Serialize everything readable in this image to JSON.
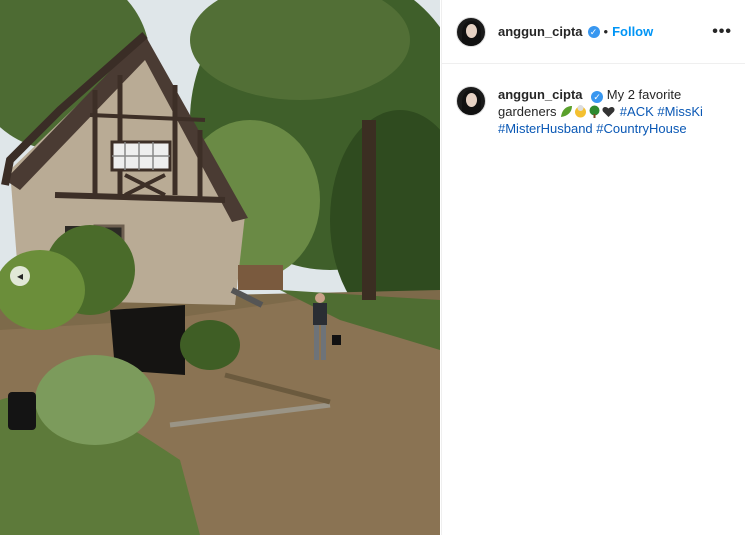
{
  "post": {
    "username": "anggun_cipta",
    "follow_label": "Follow",
    "separator": "•",
    "more_label": "•••",
    "carousel_indicator": "◂"
  },
  "caption": {
    "username": "anggun_cipta",
    "text_part1": "My 2 favorite",
    "text_part2": "gardeners",
    "emojis": [
      "leaf-emoji",
      "old-woman-emoji",
      "tree-emoji",
      "heart-emoji"
    ],
    "hashtags": [
      "#ACK",
      "#MissKi",
      "#MisterHusband",
      "#CountryHouse"
    ]
  },
  "colors": {
    "accent": "#0095f6",
    "verified": "#3897f0",
    "hashtag": "#0a58b5"
  }
}
